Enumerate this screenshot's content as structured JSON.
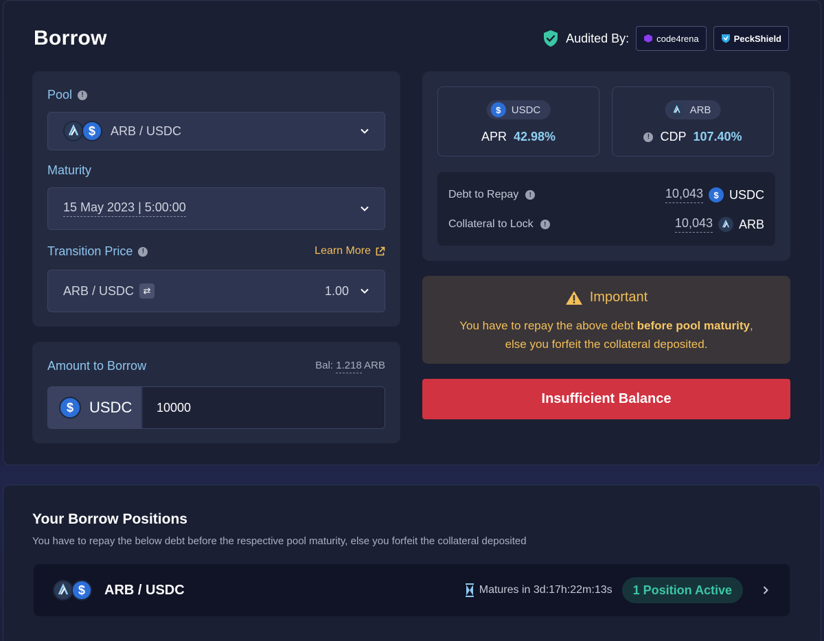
{
  "header": {
    "title": "Borrow",
    "audited_label": "Audited By:",
    "auditors": [
      "code4rena",
      "PeckShield"
    ]
  },
  "form": {
    "pool_label": "Pool",
    "pool_value": "ARB / USDC",
    "maturity_label": "Maturity",
    "maturity_value": "15 May 2023 | 5:00:00",
    "transition_label": "Transition Price",
    "learn_more": "Learn More",
    "transition_pair": "ARB / USDC",
    "transition_value": "1.00"
  },
  "amount": {
    "label": "Amount to Borrow",
    "bal_prefix": "Bal:",
    "bal_value": "1.218",
    "bal_token": "ARB",
    "token": "USDC",
    "input_value": "10000"
  },
  "stats": {
    "usdc_chip": "USDC",
    "apr_label": "APR",
    "apr_value": "42.98%",
    "arb_chip": "ARB",
    "cdp_label": "CDP",
    "cdp_value": "107.40%",
    "debt_label": "Debt to Repay",
    "debt_value": "10,043",
    "debt_token": "USDC",
    "collateral_label": "Collateral to Lock",
    "collateral_value": "10,043",
    "collateral_token": "ARB"
  },
  "important": {
    "title": "Important",
    "text_before": "You have to repay the above debt ",
    "text_bold": "before pool maturity",
    "text_after": ",",
    "text_line2": "else you forfeit the collateral deposited."
  },
  "action": {
    "button_label": "Insufficient Balance"
  },
  "positions": {
    "title": "Your Borrow Positions",
    "subtitle": "You have to repay the below debt before the respective pool maturity, else you forfeit the collateral deposited",
    "rows": [
      {
        "pair": "ARB / USDC",
        "matures": "Matures in 3d:17h:22m:13s",
        "status": "1 Position Active"
      }
    ]
  },
  "colors": {
    "accent_blue": "#8fc6ef",
    "warning": "#f2bf59",
    "danger": "#d13341",
    "success": "#3cc7a4"
  }
}
